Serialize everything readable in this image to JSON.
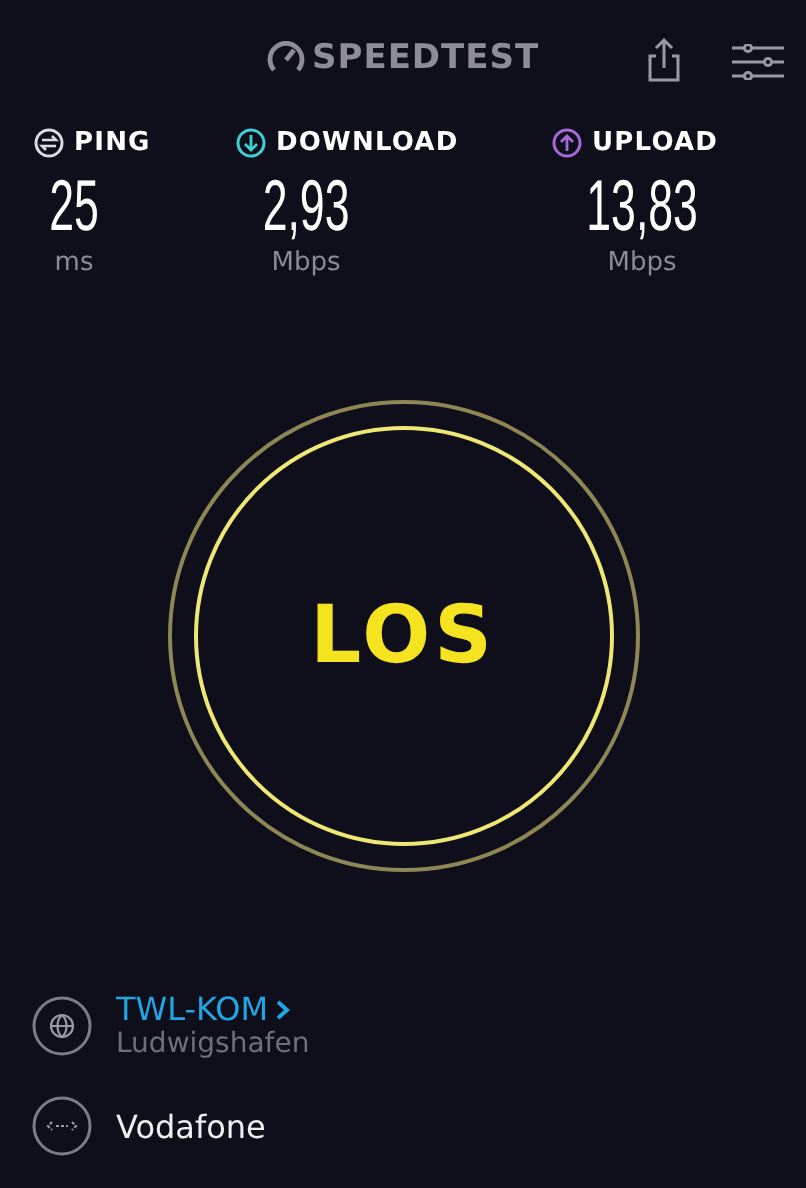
{
  "header": {
    "logo": "SPEEDTEST"
  },
  "metrics": [
    {
      "kind": "ping",
      "label": "PING",
      "value": "25",
      "unit": "ms"
    },
    {
      "kind": "download",
      "label": "DOWNLOAD",
      "value": "2,93",
      "unit": "Mbps"
    },
    {
      "kind": "upload",
      "label": "UPLOAD",
      "value": "13,83",
      "unit": "Mbps"
    }
  ],
  "go_button": {
    "label": "LOS"
  },
  "server": {
    "name": "TWL-KOM",
    "location": "Ludwigshafen"
  },
  "provider": {
    "name": "Vodafone"
  }
}
